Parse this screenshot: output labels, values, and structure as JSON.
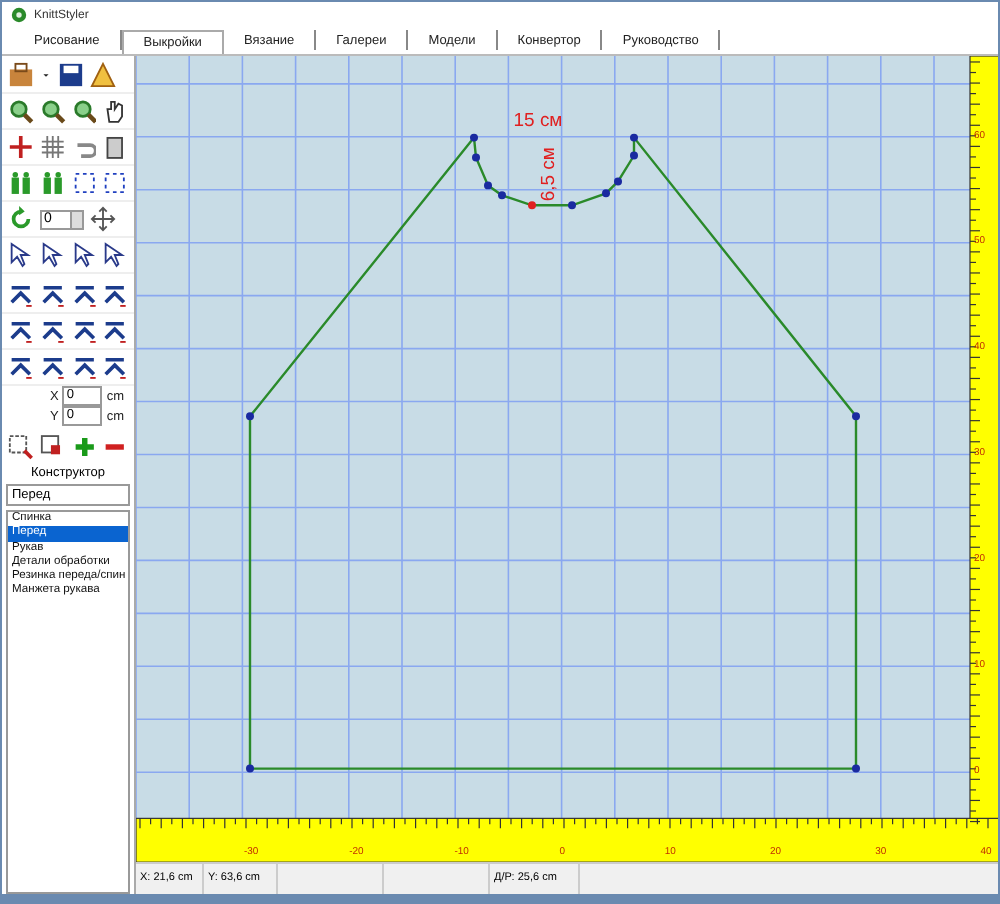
{
  "window": {
    "title": "KnittStyler"
  },
  "tabs": [
    {
      "label": "Рисование",
      "selected": false
    },
    {
      "label": "Выкройки",
      "selected": true
    },
    {
      "label": "Вязание",
      "selected": false
    },
    {
      "label": "Галереи",
      "selected": false
    },
    {
      "label": "Модели",
      "selected": false
    },
    {
      "label": "Конвертор",
      "selected": false
    },
    {
      "label": "Руководство",
      "selected": false
    }
  ],
  "panel": {
    "rotation_value": "0",
    "x_label": "X",
    "x_value": "0",
    "x_unit": "cm",
    "y_label": "Y",
    "y_value": "0",
    "y_unit": "cm",
    "section_title": "Конструктор",
    "part_field": "Перед",
    "parts": [
      {
        "label": "Спинка",
        "selected": false
      },
      {
        "label": "Перед",
        "selected": true
      },
      {
        "label": "Рукав",
        "selected": false
      },
      {
        "label": "Детали обработки",
        "selected": false
      },
      {
        "label": "Резинка переда/спин",
        "selected": false
      },
      {
        "label": "Манжета рукава",
        "selected": false
      }
    ]
  },
  "canvas": {
    "width_label": "15 см",
    "depth_label": "6,5 см"
  },
  "bottom_ruler": [
    "-30",
    "-20",
    "-10",
    "0",
    "10",
    "20",
    "30",
    "40"
  ],
  "right_ruler": [
    "60",
    "50",
    "40",
    "30",
    "20",
    "10",
    "0"
  ],
  "status_bar": [
    "X: 21,6 cm",
    "Y: 63,6 cm",
    "Д/Р: 25,6 cm"
  ]
}
